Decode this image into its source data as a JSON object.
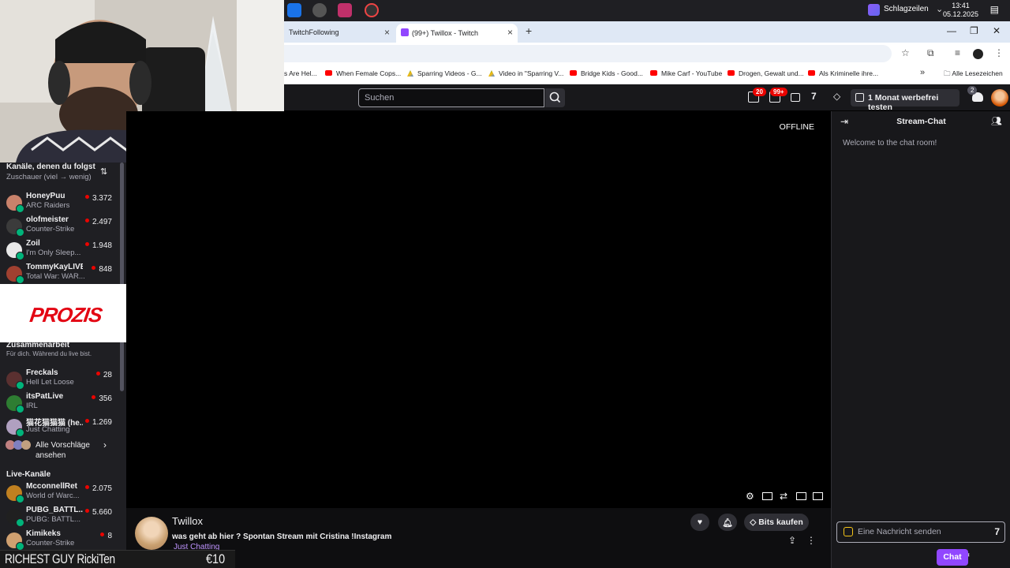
{
  "taskbar": {
    "news_label": "Schlagzeilen",
    "time": "13:41",
    "date": "05.12.2025"
  },
  "browser": {
    "tabs": [
      {
        "label": "TwitchFollowing"
      },
      {
        "label": "(99+) Twillox - Twitch"
      }
    ],
    "bookmarks": [
      "s Are Hel...",
      "When Female Cops...",
      "Sparring Videos - G...",
      "Video in \"Sparring V...",
      "Bridge Kids - Good...",
      "Mike Carf - YouTube",
      "Drogen, Gewalt und...",
      "Als Kriminelle ihre..."
    ],
    "all_bookmarks": "Alle Lesezeichen"
  },
  "nav": {
    "search_placeholder": "Suchen",
    "badge_notifications": "20",
    "badge_inbox": "99+",
    "badge_drops": "2",
    "turbo_label": "1 Monat werbefrei testen"
  },
  "sidebar": {
    "followed_title": "Kanäle, denen du folgst",
    "followed_sort": "Zuschauer (viel → wenig)",
    "followed": [
      {
        "name": "HoneyPuu",
        "game": "ARC Raiders",
        "viewers": "3.372",
        "color": "#c9826b"
      },
      {
        "name": "olofmeister",
        "game": "Counter-Strike",
        "viewers": "2.497",
        "color": "#3b3b3b"
      },
      {
        "name": "Zoil",
        "game": "I'm Only Sleep...",
        "viewers": "1.948",
        "color": "#e8e8e8"
      },
      {
        "name": "TommyKayLIVE",
        "game": "Total War: WAR...",
        "viewers": "848",
        "color": "#a04030"
      }
    ],
    "collab_title": "Zusammenarbeit",
    "collab_sub": "Für dich. Während du live bist.",
    "collab": [
      {
        "name": "Freckals",
        "game": "Hell Let Loose",
        "viewers": "28",
        "color": "#5a3030"
      },
      {
        "name": "itsPatLive",
        "game": "IRL",
        "viewers": "356",
        "color": "#2e7d32"
      },
      {
        "name": "猫花猫猫猫 (he...",
        "game": "Just Chatting",
        "viewers": "1.269",
        "color": "#b0a0c0"
      }
    ],
    "more_suggestions": "Alle Vorschläge ansehen",
    "live_title": "Live-Kanäle",
    "live": [
      {
        "name": "McconnellRet",
        "game": "World of Warc...",
        "viewers": "2.075",
        "color": "#c08020"
      },
      {
        "name": "PUBG_BATTL...",
        "game": "PUBG: BATTL...",
        "viewers": "5.660",
        "color": "#202020"
      },
      {
        "name": "Kimikeks",
        "game": "Counter-Strike",
        "viewers": "8",
        "color": "#d0a070"
      }
    ]
  },
  "ad": {
    "brand": "PROZIS"
  },
  "player": {
    "status": "OFFLINE"
  },
  "stream": {
    "channel": "Twillox",
    "title": "was geht ab hier ? Spontan Stream mit Cristina !Instagram",
    "category": "Just Chatting",
    "bits_label": "Bits kaufen"
  },
  "chat": {
    "title": "Stream-Chat",
    "welcome": "Welcome to the chat room!",
    "input_placeholder": "Eine Nachricht senden",
    "send_label": "Chat"
  },
  "donation": {
    "text": "RICHEST GUY RickiTen",
    "amount": "€10"
  },
  "colors": {
    "accent": "#9147ff",
    "live": "#eb0400",
    "bg": "#0e0e10",
    "sidebar": "#1f1f23"
  }
}
